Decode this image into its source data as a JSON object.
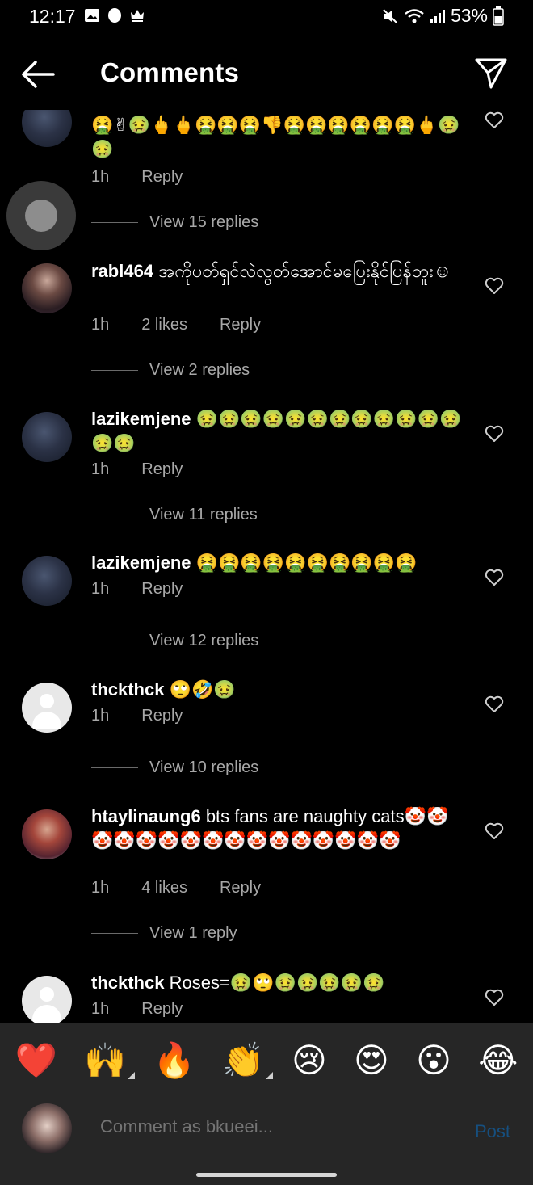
{
  "status_bar": {
    "time": "12:17",
    "battery": "53%"
  },
  "header": {
    "title": "Comments"
  },
  "comments": [
    {
      "username": "",
      "text": "🤮✌🤢🖕🖕🤮🤮🤮👎🤮🤮🤮🤮🤮🤮🖕🤢🤢",
      "time": "1h",
      "likes": "",
      "reply_label": "Reply",
      "view_replies": "View 15 replies"
    },
    {
      "username": "rabl464",
      "text": "အကိုပတ်ရှင်လဲလွတ်အောင်မပြေးနိုင်ပြန်ဘူး☺",
      "time": "1h",
      "likes": "2 likes",
      "reply_label": "Reply",
      "view_replies": "View 2 replies"
    },
    {
      "username": "lazikemjene",
      "text": "🤢🤢🤢🤢🤢🤢🤢🤢🤢🤢🤢🤢🤢🤢",
      "time": "1h",
      "likes": "",
      "reply_label": "Reply",
      "view_replies": "View 11 replies"
    },
    {
      "username": "lazikemjene",
      "text": "🤮🤮🤮🤮🤮🤮🤮🤮🤮🤮",
      "time": "1h",
      "likes": "",
      "reply_label": "Reply",
      "view_replies": "View 12 replies"
    },
    {
      "username": "thckthck",
      "text": "🙄🤣🤢",
      "time": "1h",
      "likes": "",
      "reply_label": "Reply",
      "view_replies": "View 10 replies"
    },
    {
      "username": "htaylinaung6",
      "text": "bts fans are naughty cats🤡🤡🤡🤡🤡🤡🤡🤡🤡🤡🤡🤡🤡🤡🤡🤡",
      "time": "1h",
      "likes": "4 likes",
      "reply_label": "Reply",
      "view_replies": "View 1 reply"
    },
    {
      "username": "thckthck",
      "text": "Roses=🤢🙄🤢🤢🤢🤢🤢",
      "time": "1h",
      "likes": "",
      "reply_label": "Reply",
      "view_replies": ""
    }
  ],
  "reactions": [
    "❤️",
    "🙌",
    "🔥",
    "👏",
    "😢",
    "😍",
    "😮",
    "😂"
  ],
  "compose": {
    "placeholder": "Comment as bkueei...",
    "post_label": "Post"
  }
}
